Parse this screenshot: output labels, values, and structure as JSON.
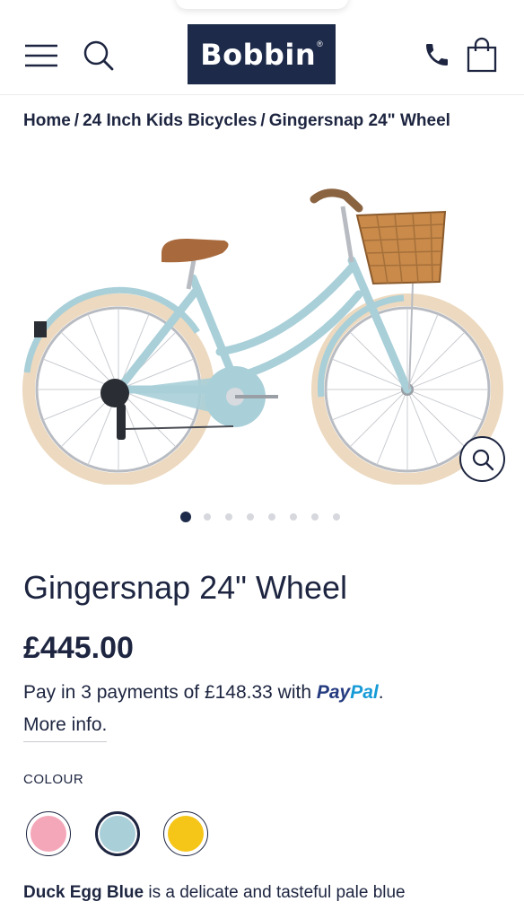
{
  "header": {
    "logo_text": "Bobbin",
    "logo_mark": "®",
    "icons": [
      "menu-icon",
      "search-icon",
      "phone-icon",
      "bag-icon"
    ]
  },
  "breadcrumb": {
    "items": [
      "Home",
      "24 Inch Kids Bicycles",
      "Gingersnap 24\" Wheel"
    ],
    "separator": "/"
  },
  "gallery": {
    "image_alt": "Gingersnap 24\" Wheel bicycle in Duck Egg Blue with wicker basket",
    "dot_count": 8,
    "active_dot": 0
  },
  "product": {
    "title": "Gingersnap 24\" Wheel",
    "price": "£445.00",
    "pay_prefix": "Pay in 3 payments of £148.33 with",
    "paypal_part1": "Pay",
    "paypal_part2": "Pal",
    "pay_suffix": ".",
    "more_info": "More info."
  },
  "colour": {
    "label": "COLOUR",
    "options": [
      {
        "name": "Pink",
        "hex": "#f4a7b9"
      },
      {
        "name": "Duck Egg Blue",
        "hex": "#a9cfd8"
      },
      {
        "name": "Yellow",
        "hex": "#f5c518"
      }
    ],
    "selected": "Duck Egg Blue"
  },
  "description": {
    "highlight": "Duck Egg Blue",
    "text": " is a delicate and tasteful pale blue"
  },
  "colors": {
    "navy": "#1d2a4a",
    "text": "#1d2540",
    "frame": "#a9cfd8",
    "tyre": "#ecd9bf"
  }
}
